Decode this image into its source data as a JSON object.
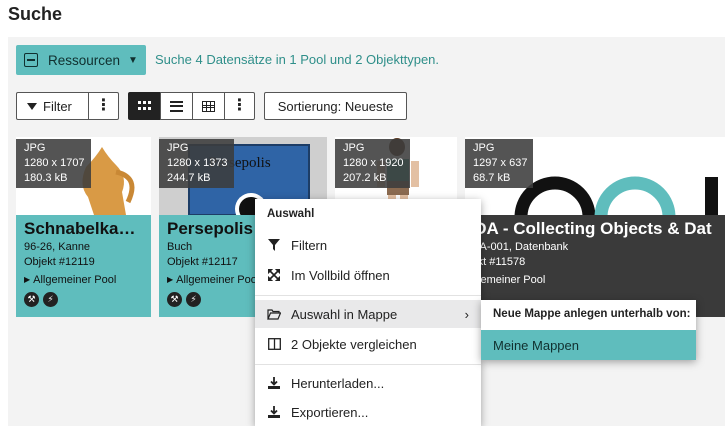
{
  "page": {
    "title": "Suche"
  },
  "toolbar": {
    "resources_label": "Ressourcen",
    "search_info": "Suche 4 Datensätze in 1 Pool und 2 Objekttypen.",
    "filter_label": "Filter",
    "sort_label": "Sortierung: Neueste"
  },
  "cards": [
    {
      "format": "JPG",
      "dims": "1280 x 1707",
      "size": "180.3 kB",
      "title": "Schnabelka…",
      "line1": "96-26, Kanne",
      "line2": "Objekt #12119",
      "pool": "Allgemeiner Pool"
    },
    {
      "format": "JPG",
      "dims": "1280 x 1373",
      "size": "244.7 kB",
      "title": "Persepolis -",
      "line1": "Buch",
      "line2": "Objekt #12117",
      "pool": "Allgemeiner Poo",
      "cover_text": "Persepolis"
    },
    {
      "format": "JPG",
      "dims": "1280 x 1920",
      "size": "207.2 kB",
      "title": "",
      "line1": "",
      "line2": "",
      "pool": ""
    },
    {
      "format": "JPG",
      "dims": "1297 x 637",
      "size": "68.7 kB",
      "title": "ODA - Collecting Objects & Dat",
      "line1": "ODA-001, Datenbank",
      "line2": "bjekt #11578",
      "pool": "Allgemeiner Pool"
    }
  ],
  "context_menu": {
    "header": "Auswahl",
    "items": [
      {
        "label": "Filtern",
        "icon": "funnel-icon"
      },
      {
        "label": "Im Vollbild öffnen",
        "icon": "expand-icon"
      },
      {
        "label": "Auswahl in Mappe",
        "icon": "folder-open-icon"
      },
      {
        "label": "2 Objekte vergleichen",
        "icon": "compare-columns-icon"
      },
      {
        "label": "Herunterladen...",
        "icon": "download-icon"
      },
      {
        "label": "Exportieren...",
        "icon": "export-icon"
      }
    ]
  },
  "submenu": {
    "header": "Neue Mappe anlegen unterhalb von:",
    "item": "Meine Mappen"
  },
  "colors": {
    "accent": "#5fbdbd",
    "dark": "#222222",
    "panel": "#f3f3f3"
  }
}
